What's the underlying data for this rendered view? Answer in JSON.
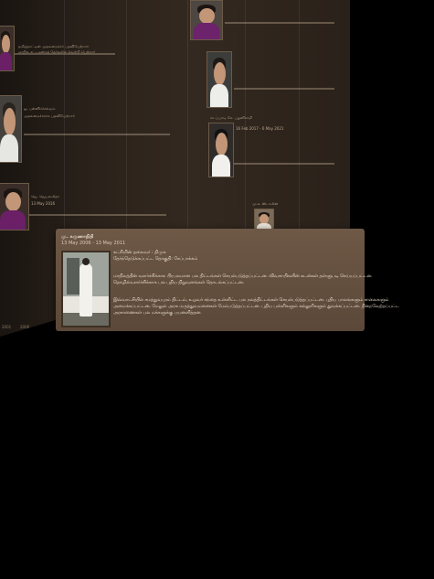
{
  "card": {
    "title": "மு. கருணாநிதி",
    "dates": "13 May 2006 - 13 May 2011",
    "lines": [
      "கட்சியின் தலைவர் : திமுக",
      "தேர்ந்தெடுக்கப்பட்ட தொகுதி: சேப்பாக்கம்",
      "",
      "மாநிலத்தின் வளர்ச்சிக்காக பிரபலமான பல திட்டங்கள் செயல்படுத்தப்பட்டன. விவசாயிகளின் கடன்கள் தள்ளுபடி செய்யப்பட்டன.",
      "தொழில்வளர்ச்சிக்காக பல புதிய நிறுவனங்கள் தொடங்கப்பட்டன.",
      "",
      "இவ்வாட்சியில் சமத்துவபுரம் திட்டம், உழவர் சந்தை உள்ளிட்ட பல நலத்திட்டங்கள் செயல்படுத்தப்பட்டன. புதிய பாலங்களும் சாலைகளும்",
      "அமைக்கப்பட்டன, மேலும் அரசு மருத்துவமனைகள் மேம்படுத்தப்பட்டன. புதிய பள்ளிகளும் கல்லூரிகளும் துவக்கப்பட்டன. நிறைவேற்றப்பட்ட",
      "அரசாணைகள் பல மக்களுக்கு பயனளித்தன."
    ]
  },
  "background_entries": [
    {
      "text": [
        "தமிழ்நாட்டின் முதலமைச்சர் பதவியேற்றார்",
        "மாநில சட்டமன்றத் தேர்தலில் வெற்றி பெற்றார்"
      ]
    },
    {
      "text": [
        "ஜெ. ஜெயலலிதா",
        "13 May 2016"
      ]
    },
    {
      "text": [
        "ஓ. பன்னீர்செல்வம்",
        "முதலமைச்சராக பதவியேற்றார்"
      ]
    },
    {
      "text": [
        "எடப்பாடி கே. பழனிசாமி",
        "16 Feb 2017 - 6 May 2021"
      ]
    },
    {
      "text": [
        "மு.க. ஸ்டாலின்"
      ]
    }
  ],
  "axis": {
    "ticks": [
      "2001",
      "2006",
      "2011"
    ]
  },
  "colors": {
    "card_bg": "#6e5846",
    "wall_bg": "#2b221b",
    "page_bg": "#000000"
  }
}
